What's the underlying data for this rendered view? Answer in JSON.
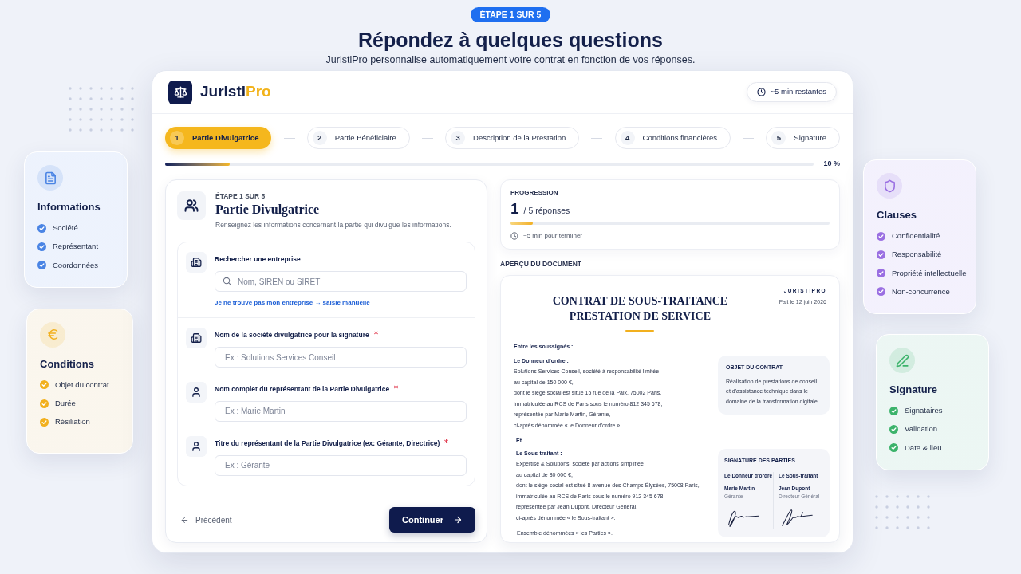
{
  "intro": {
    "step_badge": "ÉTAPE 1 SUR 5",
    "title": "Répondez à quelques questions",
    "subtitle": "JuristiPro personnalise automatiquement votre contrat en fonction de vos réponses."
  },
  "left_cards": [
    {
      "title": "Informations",
      "color": "#4a84e4",
      "items": [
        {
          "label": "Société",
          "checked": true
        },
        {
          "label": "Représentant",
          "checked": true
        },
        {
          "label": "Coordonnées",
          "checked": true
        }
      ]
    },
    {
      "title": "Conditions",
      "color": "#f2b01e",
      "items": [
        {
          "label": "Objet du contrat",
          "checked": true
        },
        {
          "label": "Durée",
          "checked": true
        },
        {
          "label": "Résiliation",
          "checked": true
        }
      ]
    }
  ],
  "app": {
    "brand": {
      "name": "Juristi",
      "accent": "Pro"
    },
    "time_left": "~5 min restantes",
    "steps": [
      {
        "number": "1",
        "label": "Partie Divulgatrice",
        "selected": true
      },
      {
        "number": "2",
        "label": "Partie Bénéficiaire",
        "selected": false
      },
      {
        "number": "3",
        "label": "Description de la Prestation",
        "selected": false
      },
      {
        "number": "4",
        "label": "Conditions financières",
        "selected": false
      },
      {
        "number": "5",
        "label": "Signature",
        "selected": false
      }
    ],
    "progress": {
      "level": 0.1,
      "reading": "10 %"
    },
    "form": {
      "step_label": "ÉTAPE 1 SUR 5",
      "title": "Partie Divulgatrice",
      "description": "Renseignez les informations concernant la partie qui divulgue les informations.",
      "search": {
        "label": "Rechercher une entreprise",
        "placeholder": "Nom, SIREN ou SIRET",
        "link": "Je ne trouve pas mon entreprise → saisie manuelle"
      },
      "fields": [
        {
          "label": "Nom de la société divulgatrice pour la signature",
          "required": true,
          "placeholder": "Ex : Solutions Services Conseil"
        },
        {
          "label": "Nom complet du représentant de la Partie Divulgatrice",
          "required": true,
          "placeholder": "Ex : Marie Martin"
        },
        {
          "label": "Titre du représentant de la Partie Divulgatrice (ex: Gérante, Directrice)",
          "required": true,
          "placeholder": "Ex : Gérante"
        }
      ],
      "back_button": "Précédent",
      "next_button": "Continuer"
    },
    "progression": {
      "label": "PROGRESSION",
      "count": "1",
      "total": "/ 5 réponses",
      "level": 0.07,
      "time": "~5 min pour terminer"
    },
    "preview": {
      "label": "APERÇU DU DOCUMENT",
      "document": {
        "title_lines": [
          "CONTRAT DE SOUS-TRAITANCE",
          "PRESTATION DE SERVICE"
        ],
        "brand": "JURISTIPRO",
        "date": "Fait le 12 juin 2026",
        "intro": "Entre les soussignés :",
        "parties": [
          {
            "heading": "Le Donneur d'ordre :",
            "lines": [
              "Solutions Services Conseil, société à responsabilité limitée",
              "au capital de 150 000 €,",
              "dont le siège social est situé 15 rue de la Paix, 75002 Paris,",
              "immatriculée au RCS de Paris sous le numéro 812 345 678,",
              "représentée par Marie Martin, Gérante,",
              "ci-après dénommée « le Donneur d'ordre »."
            ]
          },
          {
            "heading": "Le Sous-traitant :",
            "lines": [
              "Expertise & Solutions, société par actions simplifiée",
              "au capital de 80 000 €,",
              "dont le siège social est situé 8 avenue des Champs-Élysées, 75008 Paris,",
              "immatriculée au RCS de Paris sous le numéro 912 345 678,",
              "représentée par Jean Dupont, Directeur Général,",
              "ci-après dénommée « le Sous-traitant »."
            ]
          }
        ],
        "conjunction": "Et",
        "closing": "Ensemble dénommées « les Parties ».",
        "object": {
          "heading": "OBJET DU CONTRAT",
          "text": "Réalisation de prestations de conseil et d'assistance technique dans le domaine de la transformation digitale."
        },
        "signatures": {
          "heading": "SIGNATURE DES PARTIES",
          "signers": [
            {
              "role": "Le Donneur d'ordre",
              "name": "Marie Martin",
              "title": "Gérante"
            },
            {
              "role": "Le Sous-traitant",
              "name": "Jean Dupont",
              "title": "Directeur Général"
            }
          ]
        }
      }
    }
  },
  "right_cards": [
    {
      "title": "Clauses",
      "color": "#9a6fe2",
      "items": [
        {
          "label": "Confidentialité",
          "checked": true
        },
        {
          "label": "Responsabilité",
          "checked": true
        },
        {
          "label": "Propriété intellectuelle",
          "checked": true
        },
        {
          "label": "Non-concurrence",
          "checked": true
        }
      ]
    },
    {
      "title": "Signature",
      "color": "#3cb36b",
      "items": [
        {
          "label": "Signataires",
          "checked": true
        },
        {
          "label": "Validation",
          "checked": true
        },
        {
          "label": "Date & lieu",
          "checked": true
        }
      ]
    }
  ]
}
